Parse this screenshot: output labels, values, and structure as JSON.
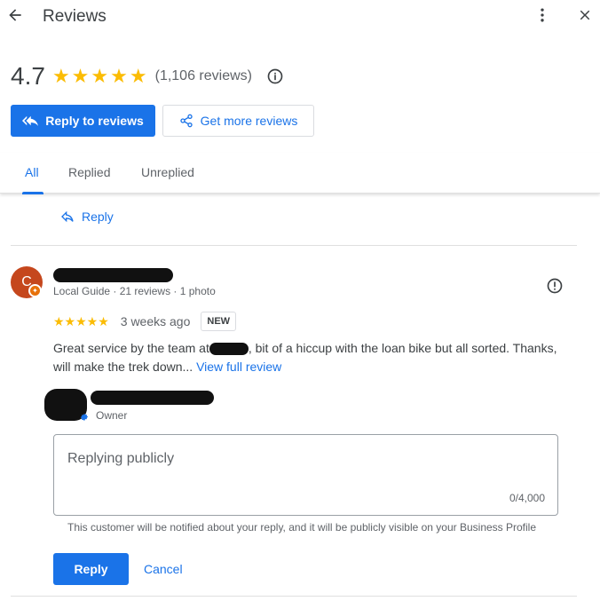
{
  "header": {
    "title": "Reviews",
    "back_icon": "arrow-back-icon",
    "more_icon": "more-vert-icon",
    "close_icon": "close-icon"
  },
  "summary": {
    "rating": "4.7",
    "stars": "★★★★★",
    "review_count": "(1,106 reviews)",
    "info_icon": "info-icon"
  },
  "actions": {
    "reply_to_reviews": "Reply to reviews",
    "get_more_reviews": "Get more reviews"
  },
  "tabs": [
    {
      "label": "All",
      "active": true
    },
    {
      "label": "Replied",
      "active": false
    },
    {
      "label": "Unreplied",
      "active": false
    }
  ],
  "previous_review": {
    "reply_label": "Reply"
  },
  "review": {
    "avatar_initial": "C",
    "reviewer_meta": "Local Guide · 21 reviews · 1 photo",
    "stars": "★★★★★",
    "date": "3 weeks ago",
    "badge": "NEW",
    "text": "Great service by the team at",
    "text_rest": ", bit of a hiccup with the loan bike but all sorted. Thanks, will make the trek down...",
    "view_full": "View full review"
  },
  "reply": {
    "owner_label": "Owner",
    "placeholder": "Replying publicly",
    "char_count": "0/4,000",
    "notice": "This customer will be notified about your reply, and it will be publicly visible on your Business Profile",
    "submit_label": "Reply",
    "cancel_label": "Cancel"
  },
  "colors": {
    "accent": "#1a73e8",
    "star": "#fbbc04",
    "avatar": "#c5471d"
  }
}
